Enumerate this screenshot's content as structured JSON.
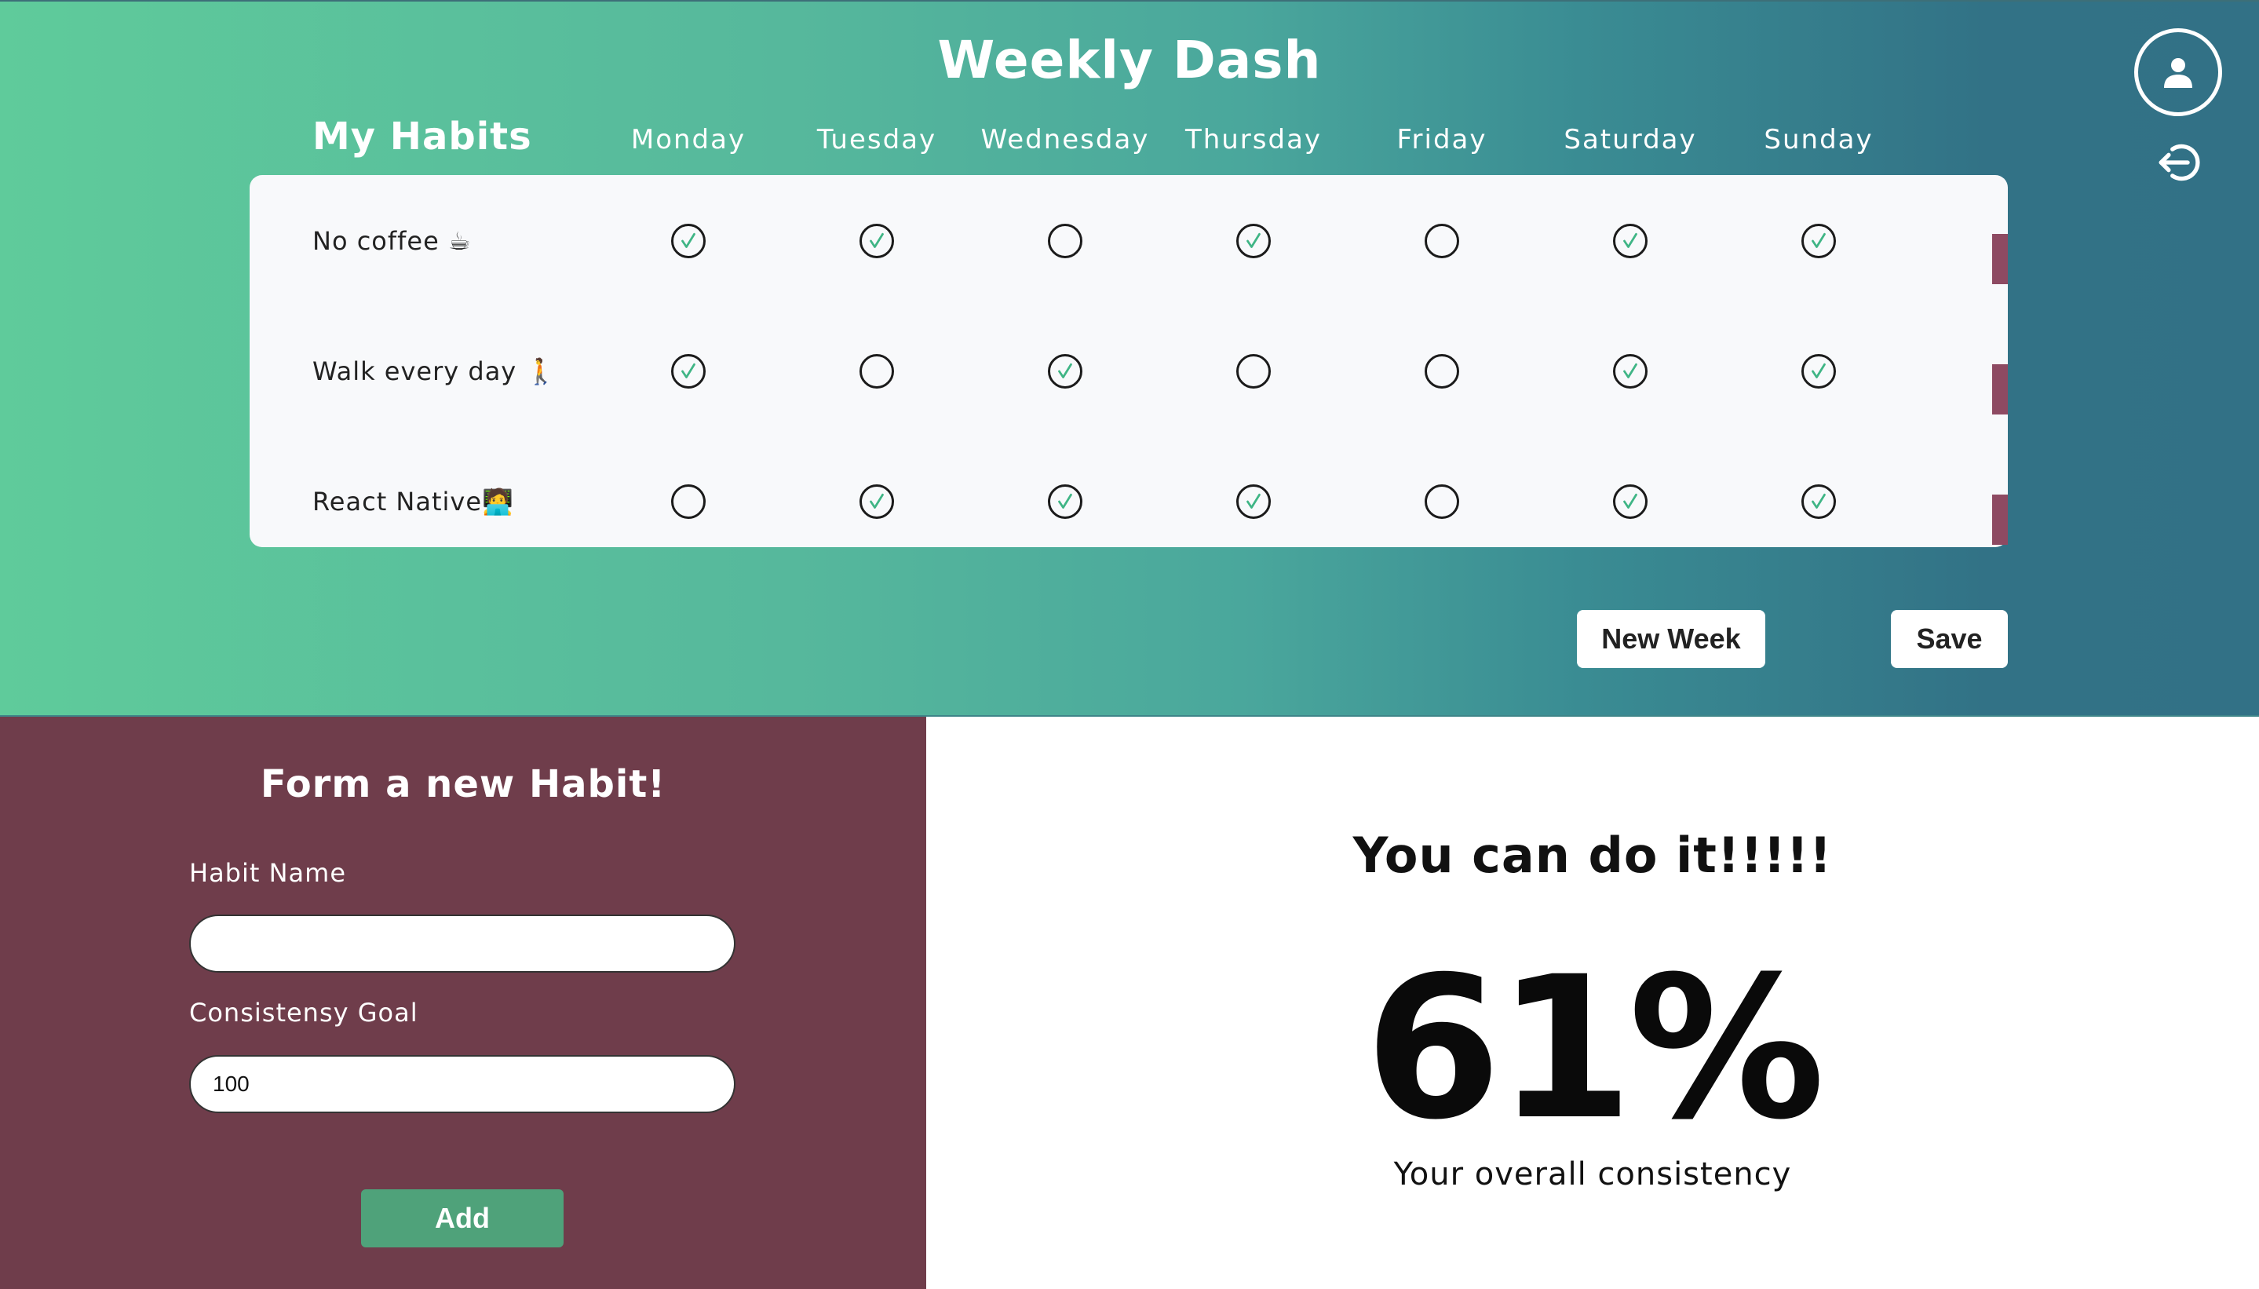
{
  "header": {
    "title": "Weekly Dash",
    "habits_heading": "My Habits",
    "days": [
      "Monday",
      "Tuesday",
      "Wednesday",
      "Thursday",
      "Friday",
      "Saturday",
      "Sunday"
    ]
  },
  "icons": {
    "profile": "user-icon",
    "logout": "logout-icon",
    "checked": "check-icon"
  },
  "habits": [
    {
      "name": "No coffee ☕",
      "checks": [
        true,
        true,
        false,
        true,
        false,
        true,
        true
      ]
    },
    {
      "name": "Walk every day 🚶",
      "checks": [
        true,
        false,
        true,
        false,
        false,
        true,
        true
      ]
    },
    {
      "name": "React Native🧑‍💻",
      "checks": [
        false,
        true,
        true,
        true,
        false,
        true,
        true
      ]
    }
  ],
  "actions": {
    "new_week": "New Week",
    "save": "Save"
  },
  "form": {
    "title": "Form a new Habit!",
    "habit_name_label": "Habit Name",
    "habit_name_value": "",
    "goal_label": "Consistensy Goal",
    "goal_value": "100",
    "add_label": "Add"
  },
  "stats": {
    "motto": "You can do it!!!!!",
    "percent": "61%",
    "percent_label": "Your overall consistency"
  },
  "colors": {
    "gradient_start": "#5fcb9b",
    "gradient_end": "#327186",
    "form_bg": "#6f3d4b",
    "add_button": "#4fa27a",
    "check_mark": "#3fb585",
    "row_tab": "#8e4a62"
  }
}
